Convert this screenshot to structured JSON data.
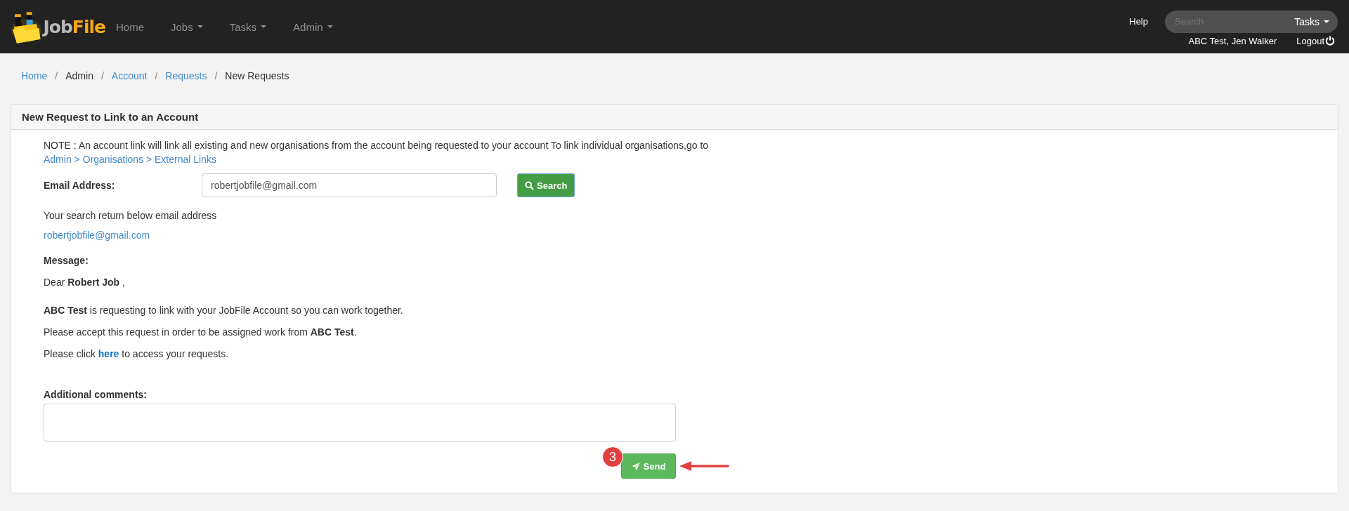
{
  "navbar": {
    "brand": {
      "first": "Job",
      "second": "File"
    },
    "items": [
      {
        "label": "Home",
        "dropdown": false
      },
      {
        "label": "Jobs",
        "dropdown": true
      },
      {
        "label": "Tasks",
        "dropdown": true
      },
      {
        "label": "Admin",
        "dropdown": true
      }
    ],
    "help": "Help",
    "search": {
      "placeholder": "Search",
      "scope": "Tasks"
    },
    "user": "ABC Test, Jen Walker",
    "logout": "Logout"
  },
  "breadcrumb": {
    "separator": "/",
    "items": [
      {
        "label": "Home",
        "link": true
      },
      {
        "label": "Admin",
        "link": false
      },
      {
        "label": "Account",
        "link": true
      },
      {
        "label": "Requests",
        "link": true
      },
      {
        "label": "New Requests",
        "link": false
      }
    ]
  },
  "panel": {
    "title": "New Request to Link to an Account",
    "note": {
      "text": "NOTE : An account link will link all existing and new organisations from the account being requested to your account To link individual organisations,go to",
      "link": "Admin > Organisations > External Links"
    },
    "email": {
      "label": "Email Address:",
      "value": "robertjobfile@gmail.com",
      "button": "Search"
    },
    "result_text": "Your search return below email address",
    "result_link": "robertjobfile@gmail.com",
    "message": {
      "label": "Message:",
      "lines": [
        "Dear **Robert Job** ,",
        "**ABC Test** is requesting to link with your JobFile Account so you can work together.",
        "Please accept this request in order to be assigned work from **ABC Test**."
      ],
      "click": {
        "before": "Please click",
        "link": "here",
        "after": "to access your requests."
      }
    },
    "comments": {
      "label": "Additional comments:"
    },
    "send": "Send",
    "annotation": {
      "step": "3"
    }
  }
}
